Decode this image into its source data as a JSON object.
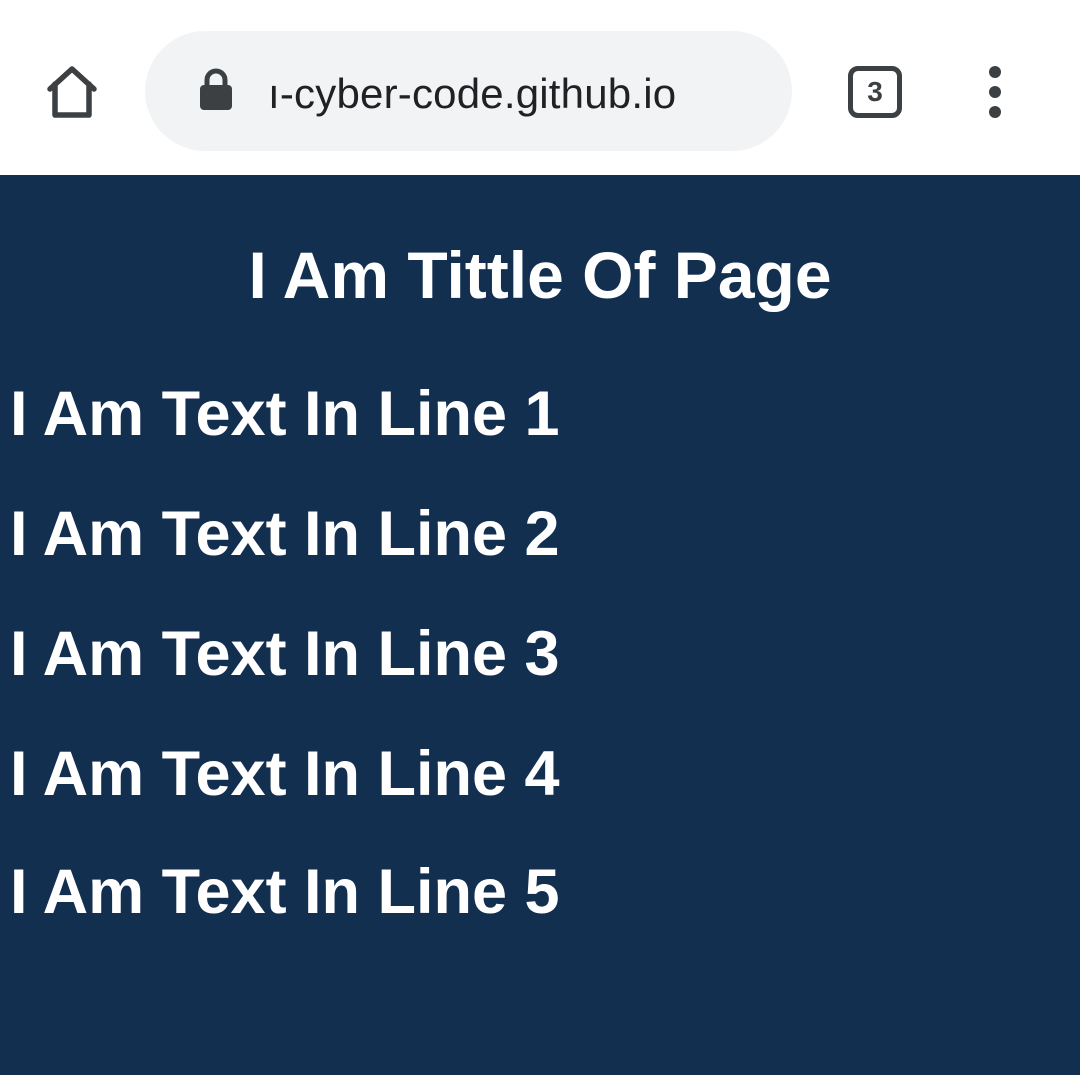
{
  "browser": {
    "url_display": "ı-cyber-code.github.io",
    "tab_count": "3"
  },
  "page": {
    "title": "I Am Tittle Of Page",
    "lines": [
      "I Am Text In Line 1",
      "I Am Text In Line 2",
      "I Am Text In Line 3",
      "I Am Text In Line 4",
      "I Am Text In Line 5"
    ],
    "background_color": "#132f50",
    "text_color": "#ffffff"
  },
  "icons": {
    "home": "home-icon",
    "lock": "lock-icon",
    "tabs": "tab-switcher-icon",
    "menu": "more-vert-icon"
  }
}
